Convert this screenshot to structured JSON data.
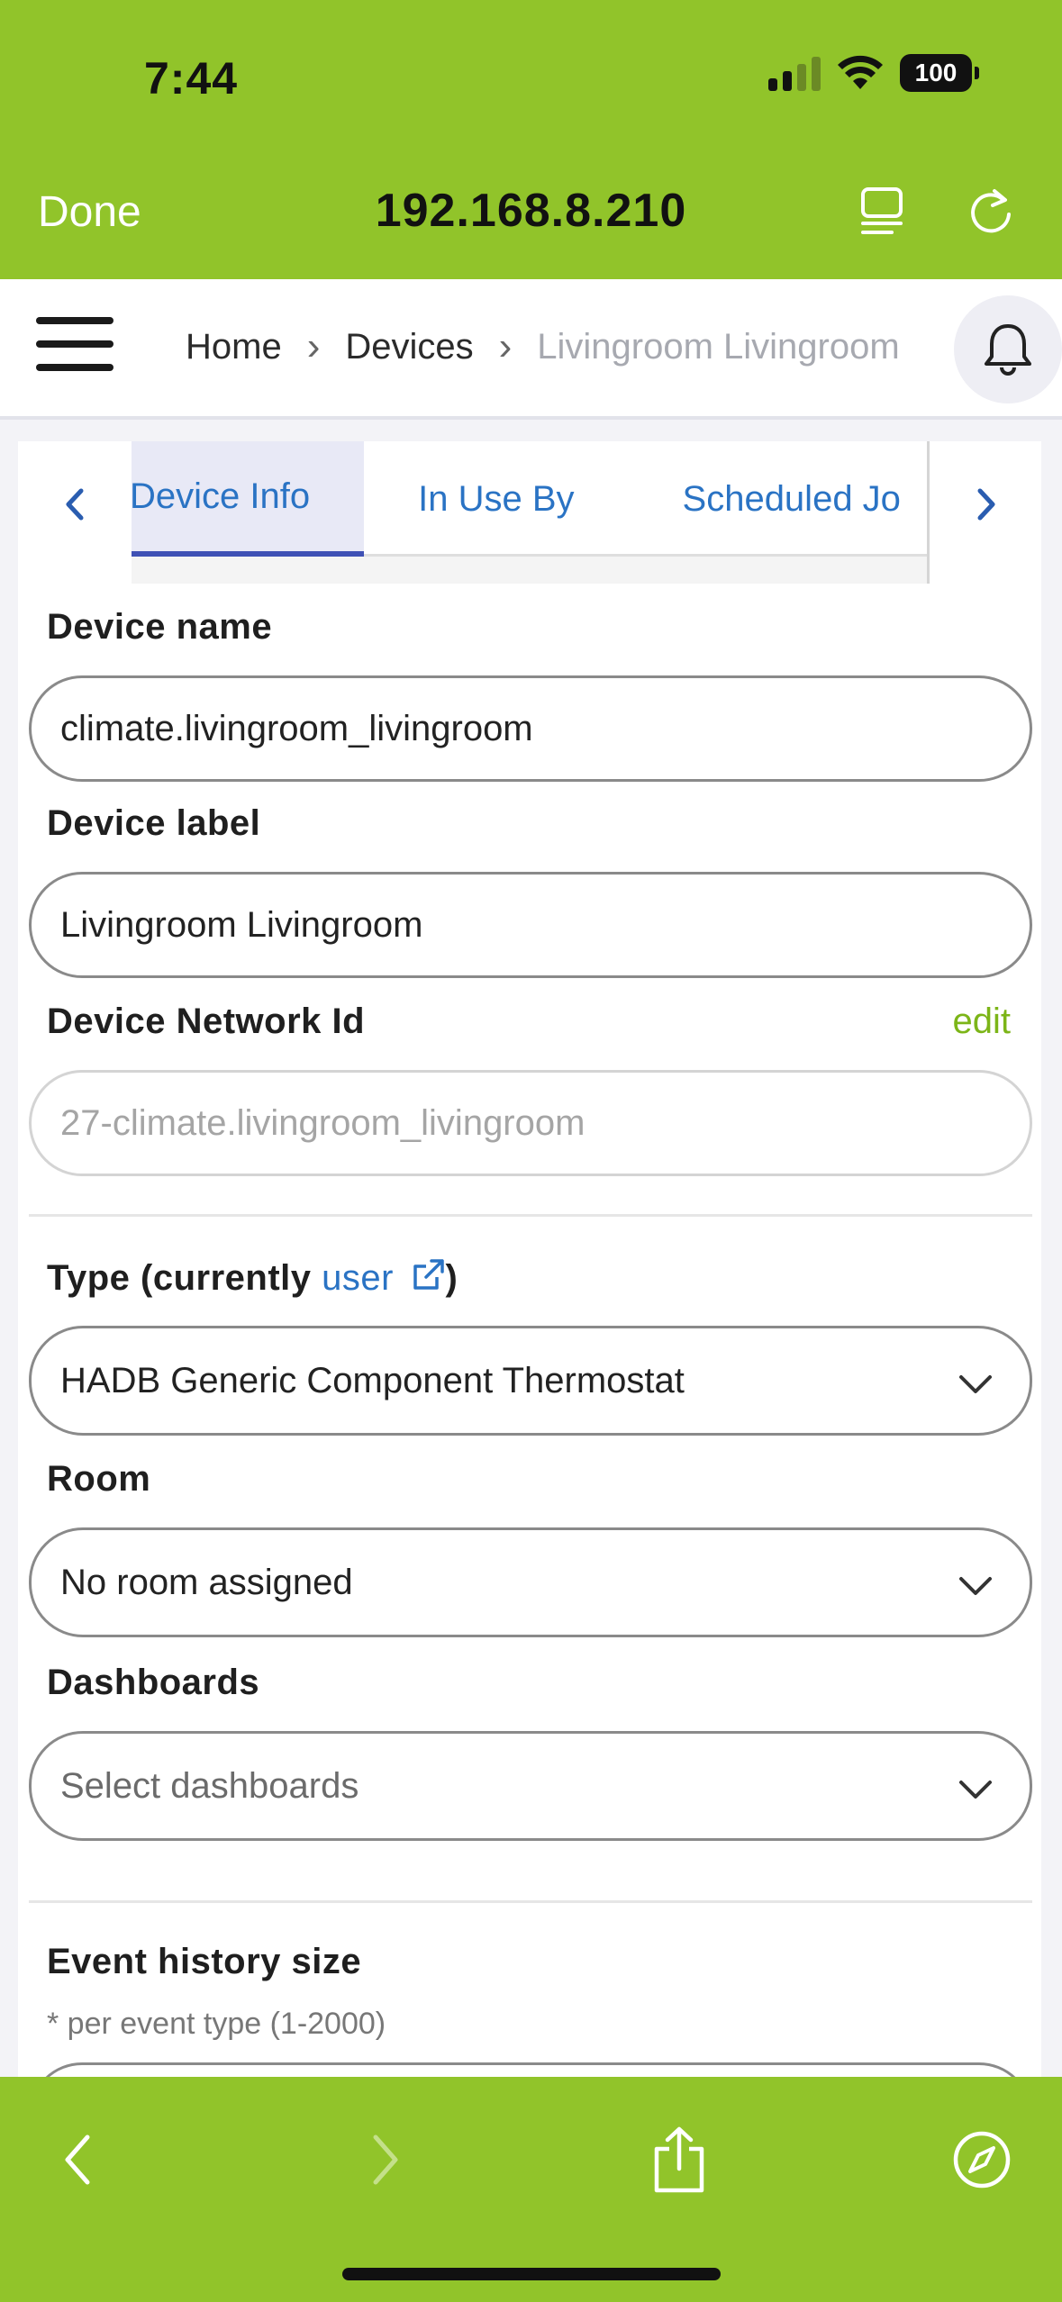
{
  "status_bar": {
    "time": "7:44",
    "battery": "100"
  },
  "browser": {
    "done_label": "Done",
    "url": "192.168.8.210"
  },
  "breadcrumb": {
    "home": "Home",
    "devices": "Devices",
    "current": "Livingroom Livingroom"
  },
  "tabs": [
    {
      "label": "Device Info",
      "active": true
    },
    {
      "label": "In Use By",
      "active": false
    },
    {
      "label": "Scheduled Jo",
      "active": false
    }
  ],
  "form": {
    "device_name_label": "Device name",
    "device_name_value": "climate.livingroom_livingroom",
    "device_label_label": "Device label",
    "device_label_value": "Livingroom Livingroom",
    "network_id_label": "Device Network Id",
    "network_id_edit": "edit",
    "network_id_value": "27-climate.livingroom_livingroom",
    "type_label_prefix": "Type (currently ",
    "type_link": "user",
    "type_label_suffix": ")",
    "type_value": "HADB Generic Component Thermostat",
    "room_label": "Room",
    "room_value": "No room assigned",
    "dashboards_label": "Dashboards",
    "dashboards_placeholder": "Select dashboards",
    "event_history_label": "Event history size",
    "event_history_hint": "* per event type (1-2000)"
  },
  "colors": {
    "brand_green": "#91c42a",
    "link_blue": "#2a73c4",
    "edit_green": "#7cb518",
    "active_tab": "#3f51b5"
  }
}
